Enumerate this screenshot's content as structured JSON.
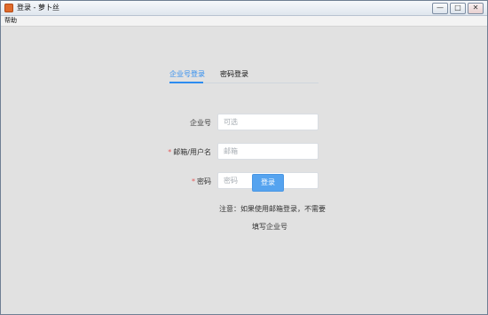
{
  "window": {
    "title": "登录 - 萝卜丝",
    "buttons": {
      "minimize": "—",
      "maximize": "□",
      "close": "✕"
    }
  },
  "menubar": {
    "help": "帮助"
  },
  "tabs": [
    {
      "label": "企业号登录",
      "active": true
    },
    {
      "label": "密码登录",
      "active": false
    }
  ],
  "form": {
    "company": {
      "label": "企业号",
      "required": false,
      "placeholder": "可选"
    },
    "email": {
      "label": "邮箱/用户名",
      "required": true,
      "placeholder": "邮箱"
    },
    "password": {
      "label": "密码",
      "required": true,
      "placeholder": "密码"
    }
  },
  "login_button": "登录",
  "note": {
    "line1": "注意：如果使用邮箱登录，不需要",
    "line2": "填写企业号"
  },
  "colors": {
    "accent": "#2d8cf0",
    "button": "#55a3ef",
    "required": "#e35959"
  },
  "icons": {
    "app": "app-icon"
  }
}
